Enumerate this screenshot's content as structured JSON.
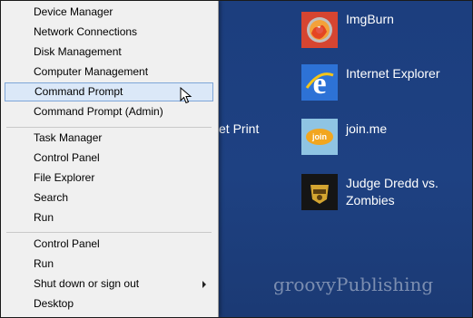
{
  "menu": {
    "groups": [
      [
        "Device Manager",
        "Network Connections",
        "Disk Management",
        "Computer Management",
        "Command Prompt",
        "Command Prompt (Admin)"
      ],
      [
        "Task Manager",
        "Control Panel",
        "File Explorer",
        "Search",
        "Run"
      ],
      [
        "Control Panel",
        "Run",
        "Shut down or sign out",
        "Desktop"
      ]
    ],
    "selected_label": "Command Prompt",
    "submenu_item": "Shut down or sign out"
  },
  "tiles": [
    {
      "label_lines": [
        "ImgBurn"
      ],
      "icon": "imgburn-icon",
      "color": "#e5523e"
    },
    {
      "label_lines": [
        "Internet Explorer"
      ],
      "icon": "internet-explorer-icon",
      "color": "#2c6fd1"
    },
    {
      "label_lines": [
        "join.me"
      ],
      "icon": "joinme-icon",
      "color": "#8cc1e0"
    },
    {
      "label_lines": [
        "Judge Dredd vs.",
        "Zombies"
      ],
      "icon": "judge-dredd-icon",
      "color": "#1a1a1a"
    }
  ],
  "partial_tile_label": "et Print",
  "watermark": "groovyPublishing",
  "colors": {
    "start_background": "#1e4182",
    "menu_background": "#f0f0f0",
    "selection_fill": "#dbe8f8",
    "selection_border": "#7ea6d8"
  }
}
